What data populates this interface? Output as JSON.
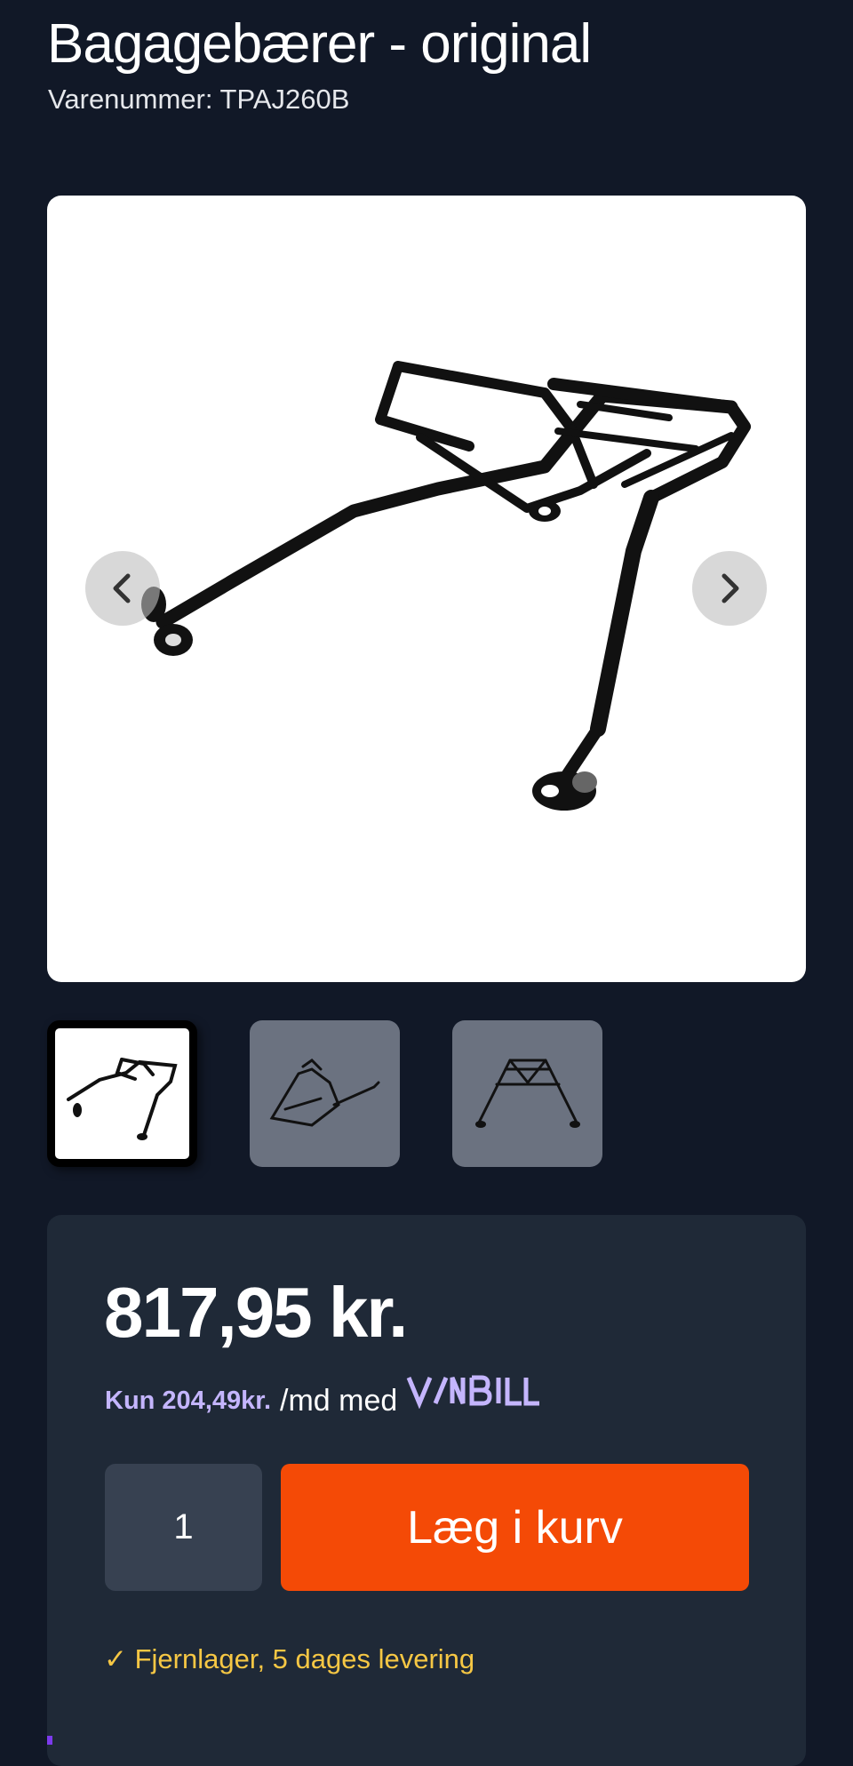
{
  "product": {
    "title": "Bagagebærer - original",
    "sku_label": "Varenummer: TPAJ260B",
    "main_image_alt": "Bagagebærer",
    "thumbnails": [
      {
        "name": "thumb-1",
        "active": true
      },
      {
        "name": "thumb-2",
        "active": false
      },
      {
        "name": "thumb-3",
        "active": false
      }
    ]
  },
  "gallery": {
    "prev_icon": "chevron-left-icon",
    "next_icon": "chevron-right-icon"
  },
  "buy_box": {
    "price": "817,95 kr.",
    "financing_amount": "Kun 204,49kr.",
    "financing_suffix": "/md med",
    "financing_brand": "VIABILL",
    "quantity": "1",
    "add_to_cart_label": "Læg i kurv",
    "stock_status": "✓ Fjernlager, 5 dages levering"
  },
  "colors": {
    "background": "#111827",
    "panel": "#1f2937",
    "accent": "#f44a06",
    "stock_text": "#f6c744",
    "viabill": "#c4b5fd"
  }
}
